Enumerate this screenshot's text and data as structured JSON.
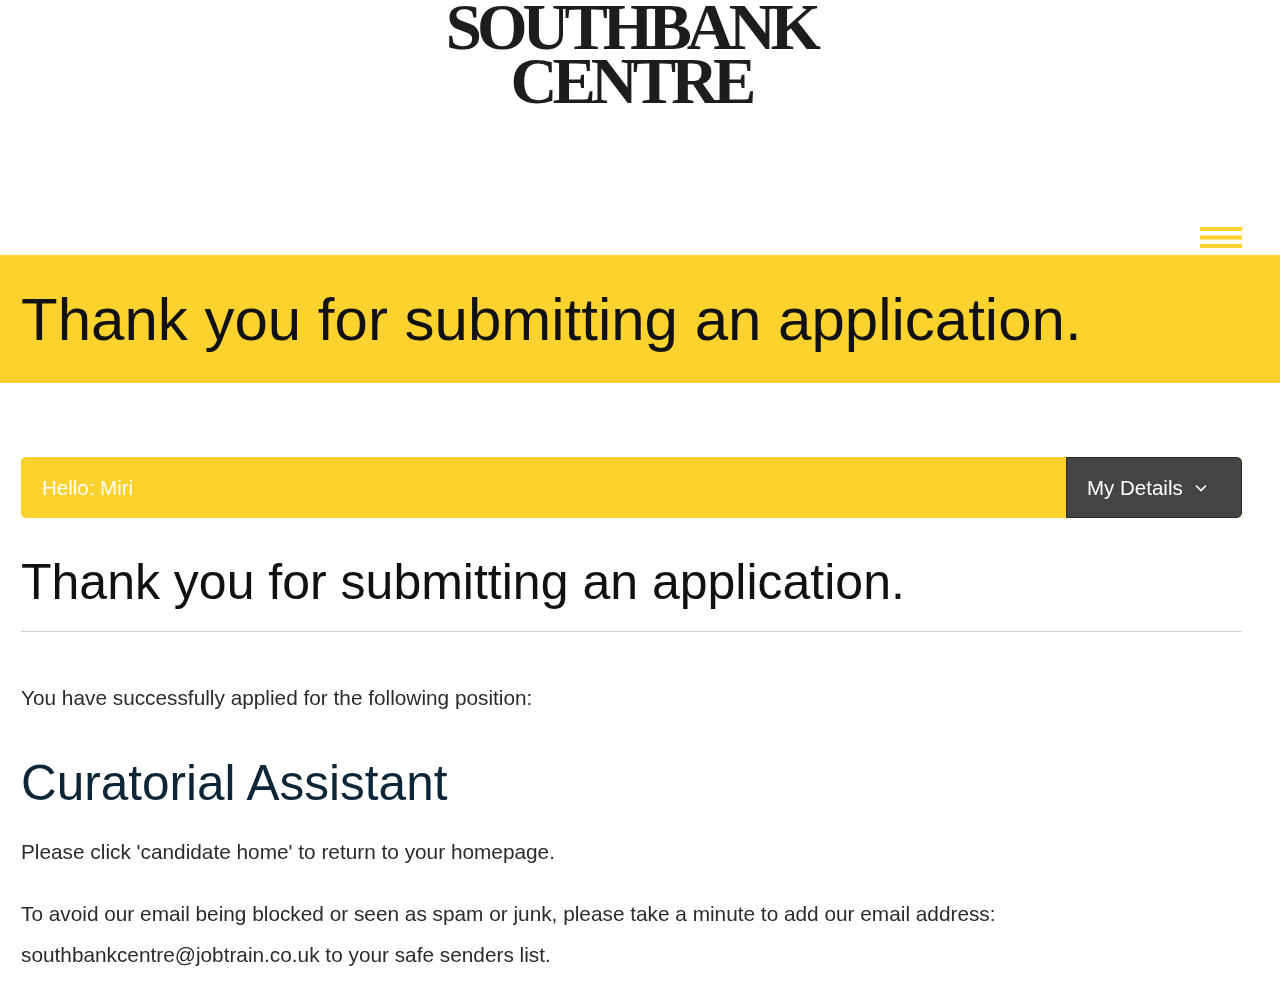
{
  "header": {
    "logo_lines": [
      "SOUTHBANK",
      "CENTRE"
    ]
  },
  "banner": {
    "title": "Thank you for submitting an application."
  },
  "user_bar": {
    "greeting": "Hello: Miri",
    "menu_button": "My Details"
  },
  "content": {
    "heading": "Thank you for submitting an application.",
    "intro": "You have successfully applied for the following position:",
    "position": "Curatorial Assistant",
    "paragraphs": [
      "Please click 'candidate home' to return to your homepage.",
      "To avoid our email being blocked or seen as spam or junk, please take a minute to add our email address: southbankcentre@jobtrain.co.uk to your safe senders list."
    ]
  }
}
